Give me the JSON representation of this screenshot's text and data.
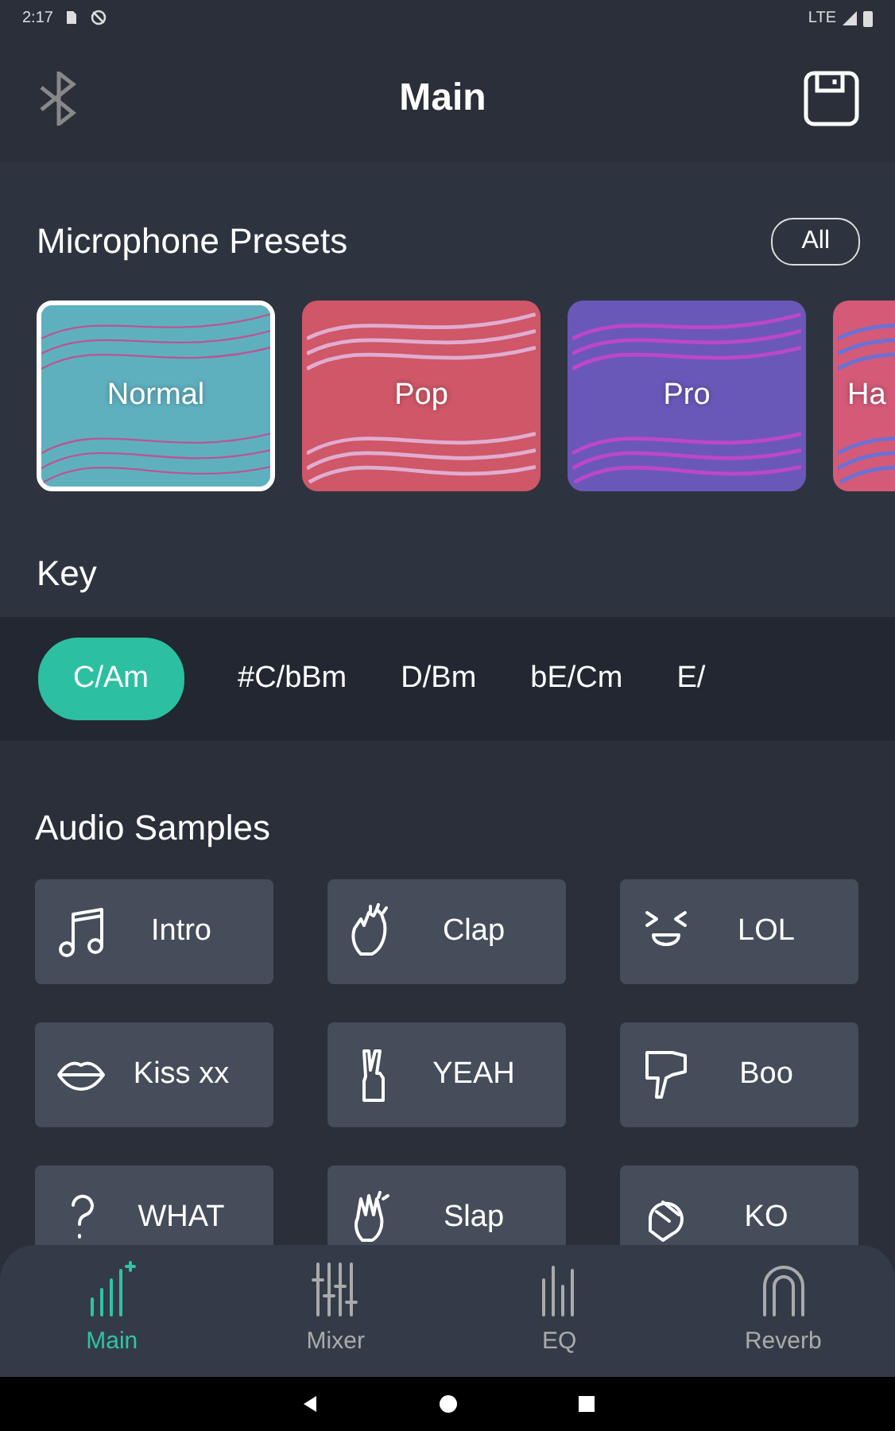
{
  "status_bar": {
    "time": "2:17",
    "network": "LTE"
  },
  "header": {
    "title": "Main"
  },
  "presets": {
    "title": "Microphone Presets",
    "all_button": "All",
    "items": [
      {
        "label": "Normal",
        "selected": true,
        "color": "#5fb0bf"
      },
      {
        "label": "Pop",
        "selected": false,
        "color": "#cf5767"
      },
      {
        "label": "Pro",
        "selected": false,
        "color": "#6a58b8"
      },
      {
        "label": "Ha",
        "selected": false,
        "color": "#d45a78"
      }
    ]
  },
  "key": {
    "title": "Key",
    "items": [
      {
        "label": "C/Am",
        "selected": true
      },
      {
        "label": "#C/bBm",
        "selected": false
      },
      {
        "label": "D/Bm",
        "selected": false
      },
      {
        "label": "bE/Cm",
        "selected": false
      },
      {
        "label": "E/",
        "selected": false
      }
    ]
  },
  "samples": {
    "title": "Audio Samples",
    "items": [
      {
        "label": "Intro"
      },
      {
        "label": "Clap"
      },
      {
        "label": "LOL"
      },
      {
        "label": "Kiss xx"
      },
      {
        "label": "YEAH"
      },
      {
        "label": "Boo"
      },
      {
        "label": "WHAT"
      },
      {
        "label": "Slap"
      },
      {
        "label": "KO"
      }
    ]
  },
  "tabs": [
    {
      "label": "Main",
      "selected": true
    },
    {
      "label": "Mixer",
      "selected": false
    },
    {
      "label": "EQ",
      "selected": false
    },
    {
      "label": "Reverb",
      "selected": false
    }
  ]
}
